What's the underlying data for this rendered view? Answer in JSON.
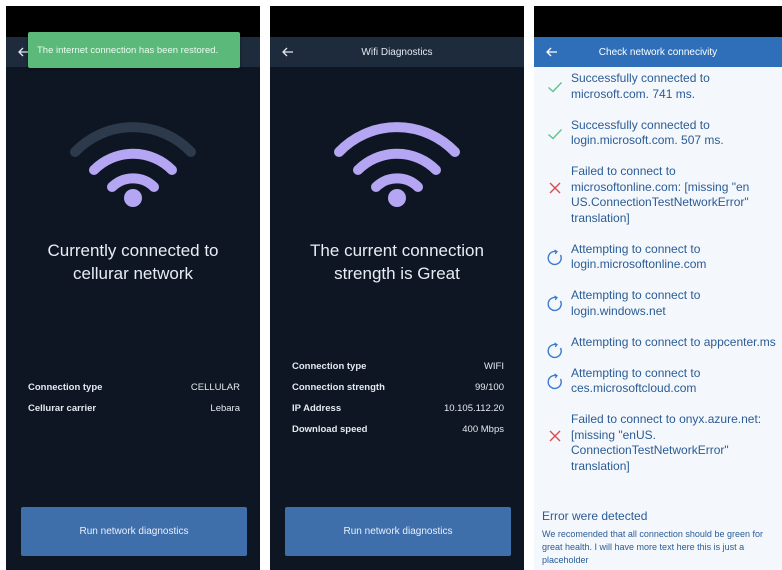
{
  "colors": {
    "dark_bg": "#0d1622",
    "wifi": "#b4a6f2",
    "wifi_dim": "#2c3a4b",
    "button": "#3f6fab",
    "toast": "#5bb97a",
    "link_text": "#2a5c97",
    "success": "#5fc48b",
    "failure": "#d84c4c",
    "pending": "#3a7bd0"
  },
  "screen1": {
    "toast": "The internet connection has been restored.",
    "headline": [
      "Currently connected to",
      "cellurar network"
    ],
    "rows": [
      {
        "key": "Connection type",
        "value": "CELLULAR"
      },
      {
        "key": "Cellurar carrier",
        "value": "Lebara"
      }
    ],
    "button": "Run network diagnostics"
  },
  "screen2": {
    "title": "Wifi Diagnostics",
    "headline": [
      "The current connection",
      "strength is Great"
    ],
    "rows": [
      {
        "key": "Connection type",
        "value": "WIFI"
      },
      {
        "key": "Connection strength",
        "value": "99/100"
      },
      {
        "key": "IP Address",
        "value": "10.105.112.20"
      },
      {
        "key": "Download speed",
        "value": "400 Mbps"
      }
    ],
    "button": "Run network diagnostics"
  },
  "screen3": {
    "title": "Check network connecivity",
    "results": [
      {
        "status": "success",
        "icon": "check-icon",
        "text": "Successfully connected to microsoft.com. 741 ms."
      },
      {
        "status": "success",
        "icon": "check-icon",
        "text": "Successfully connected to login.microsoft.com. 507 ms."
      },
      {
        "status": "failed",
        "icon": "x-icon",
        "text": "Failed to connect to microsoftonline.com: [missing \"en US.ConnectionTestNetworkError\" translation]"
      },
      {
        "status": "pending",
        "icon": "refresh-icon",
        "text": "Attempting to connect to login.microsoftonline.com"
      },
      {
        "status": "pending",
        "icon": "refresh-icon",
        "text": "Attempting to connect to login.windows.net"
      },
      {
        "status": "pending",
        "icon": "refresh-icon",
        "text": "Attempting to connect to appcenter.ms"
      },
      {
        "status": "pending",
        "icon": "refresh-icon",
        "text": "Attempting to connect to ces.microsoftcloud.com"
      },
      {
        "status": "failed",
        "icon": "x-icon",
        "text": "Failed to connect to onyx.azure.net: [missing \"enUS. ConnectionTestNetworkError\" translation]"
      }
    ],
    "error_title": "Error were detected",
    "error_desc": "We recomended that all connection should be green for great health. I will have more text here this is just a placeholder"
  }
}
